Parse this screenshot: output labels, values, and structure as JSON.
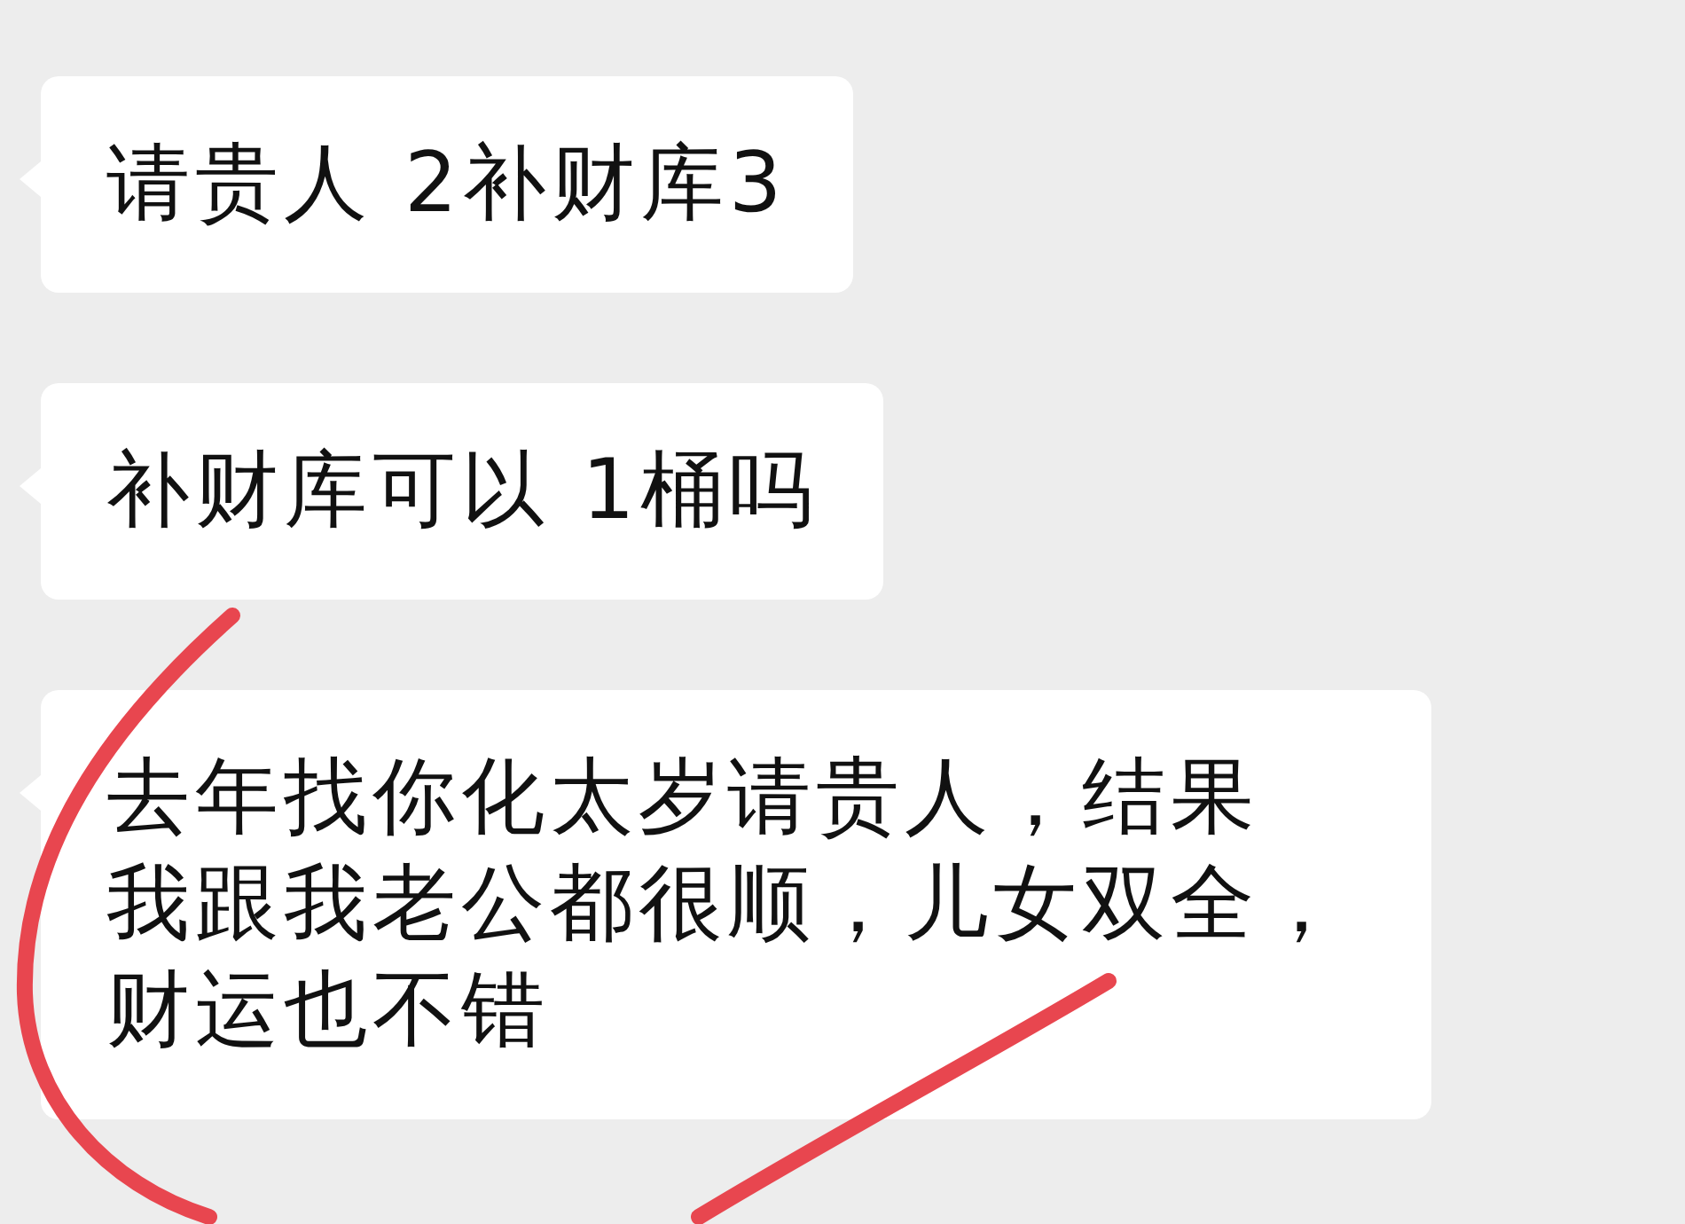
{
  "messages": [
    {
      "text": "请贵人 2补财库3"
    },
    {
      "text": "补财库可以 1桶吗"
    },
    {
      "text": "去年找你化太岁请贵人，结果我跟我老公都很顺，儿女双全，财运也不错"
    }
  ]
}
